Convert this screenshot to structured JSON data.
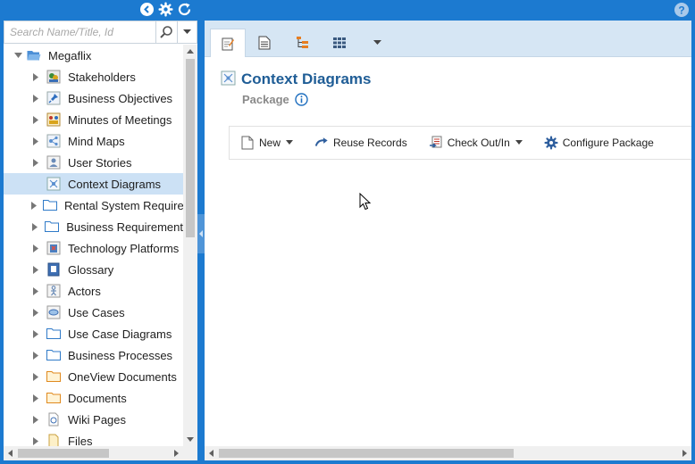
{
  "top_bar": {
    "icons": [
      "back-arrow-icon",
      "gear-icon",
      "refresh-icon"
    ],
    "help_icon": "help-icon"
  },
  "search": {
    "placeholder": "Search Name/Title, Id",
    "value": ""
  },
  "tree": {
    "root": {
      "label": "Megaflix",
      "icon": "folder-open-icon"
    },
    "items": [
      {
        "label": "Stakeholders",
        "icon": "stakeholders-icon"
      },
      {
        "label": "Business Objectives",
        "icon": "pin-icon"
      },
      {
        "label": "Minutes of Meetings",
        "icon": "meeting-icon"
      },
      {
        "label": "Mind Maps",
        "icon": "mind-map-icon"
      },
      {
        "label": "User Stories",
        "icon": "user-story-icon"
      },
      {
        "label": "Context Diagrams",
        "icon": "context-diagram-icon",
        "selected": true
      },
      {
        "label": "Rental System Require",
        "icon": "folder-icon"
      },
      {
        "label": "Business Requirement",
        "icon": "folder-icon"
      },
      {
        "label": "Technology Platforms",
        "icon": "technology-icon"
      },
      {
        "label": "Glossary",
        "icon": "glossary-icon"
      },
      {
        "label": "Actors",
        "icon": "actor-icon"
      },
      {
        "label": "Use Cases",
        "icon": "use-case-icon"
      },
      {
        "label": "Use Case Diagrams",
        "icon": "folder-icon"
      },
      {
        "label": "Business Processes",
        "icon": "folder-icon"
      },
      {
        "label": "OneView Documents",
        "icon": "folder-orange-icon"
      },
      {
        "label": "Documents",
        "icon": "folder-orange-icon"
      },
      {
        "label": "Wiki Pages",
        "icon": "wiki-icon"
      },
      {
        "label": "Files",
        "icon": "file-icon"
      }
    ]
  },
  "tabs": [
    {
      "name": "tab-details",
      "icon": "edit-document-icon",
      "active": true
    },
    {
      "name": "tab-document",
      "icon": "document-icon"
    },
    {
      "name": "tab-hierarchy",
      "icon": "hierarchy-icon"
    },
    {
      "name": "tab-grid",
      "icon": "grid-icon"
    },
    {
      "name": "tab-more",
      "icon": "chevron-down-icon"
    }
  ],
  "header": {
    "title": "Context Diagrams",
    "subtitle": "Package"
  },
  "toolbar": {
    "new_label": "New",
    "reuse_label": "Reuse Records",
    "checkout_label": "Check Out/In",
    "configure_label": "Configure Package"
  },
  "colors": {
    "frame": "#1c7ad0",
    "title": "#1f5d96",
    "selected": "#cce1f5",
    "tab_bar": "#d6e6f4"
  }
}
